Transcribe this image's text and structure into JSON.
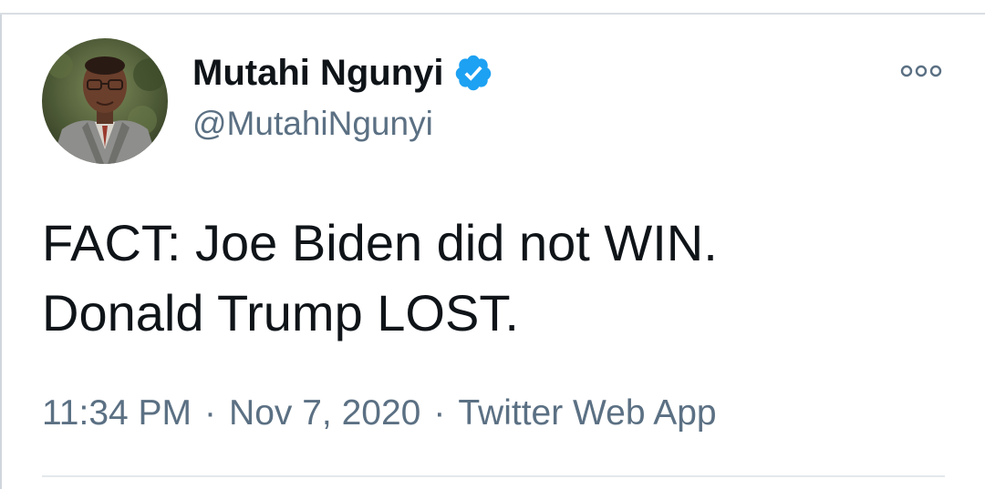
{
  "tweet": {
    "display_name": "Mutahi Ngunyi",
    "handle": "@MutahiNgunyi",
    "verified": true,
    "verified_icon": "verified-badge-icon",
    "more_icon": "more-options-icon",
    "text": "FACT: Joe Biden did not WIN.\nDonald Trump LOST.",
    "time": "11:34 PM",
    "date": "Nov 7, 2020",
    "separator": "·",
    "source": "Twitter Web App"
  },
  "colors": {
    "text_primary": "#0f1419",
    "text_secondary": "#5b7083",
    "verified_blue": "#1da1f2",
    "divider": "#e3e8ec"
  }
}
